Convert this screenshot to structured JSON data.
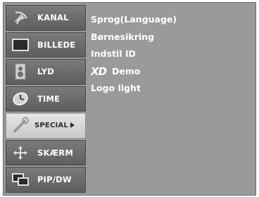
{
  "sidebar": {
    "items": [
      {
        "label": "KANAL",
        "icon": "satellite-dish-icon"
      },
      {
        "label": "BILLEDE",
        "icon": "tv-screen-icon"
      },
      {
        "label": "LYD",
        "icon": "speaker-icon"
      },
      {
        "label": "TIME",
        "icon": "clock-icon"
      },
      {
        "label": "SPECIAL",
        "icon": "wrench-icon",
        "selected": true
      },
      {
        "label": "SKÆRM",
        "icon": "move-arrows-icon"
      },
      {
        "label": "PIP/DW",
        "icon": "picture-in-picture-icon"
      }
    ]
  },
  "main": {
    "options": [
      {
        "label": "Sprog(Language)"
      },
      {
        "label": "Børnesikring"
      },
      {
        "label": "Indstil ID"
      },
      {
        "logo": "XD",
        "label": "Demo"
      },
      {
        "label": "Logo light"
      }
    ]
  },
  "colors": {
    "panel": "#9a9a9a",
    "menu_item": "#6b6b6b",
    "selected_item": "#d8d8d8",
    "text": "#ffffff"
  }
}
